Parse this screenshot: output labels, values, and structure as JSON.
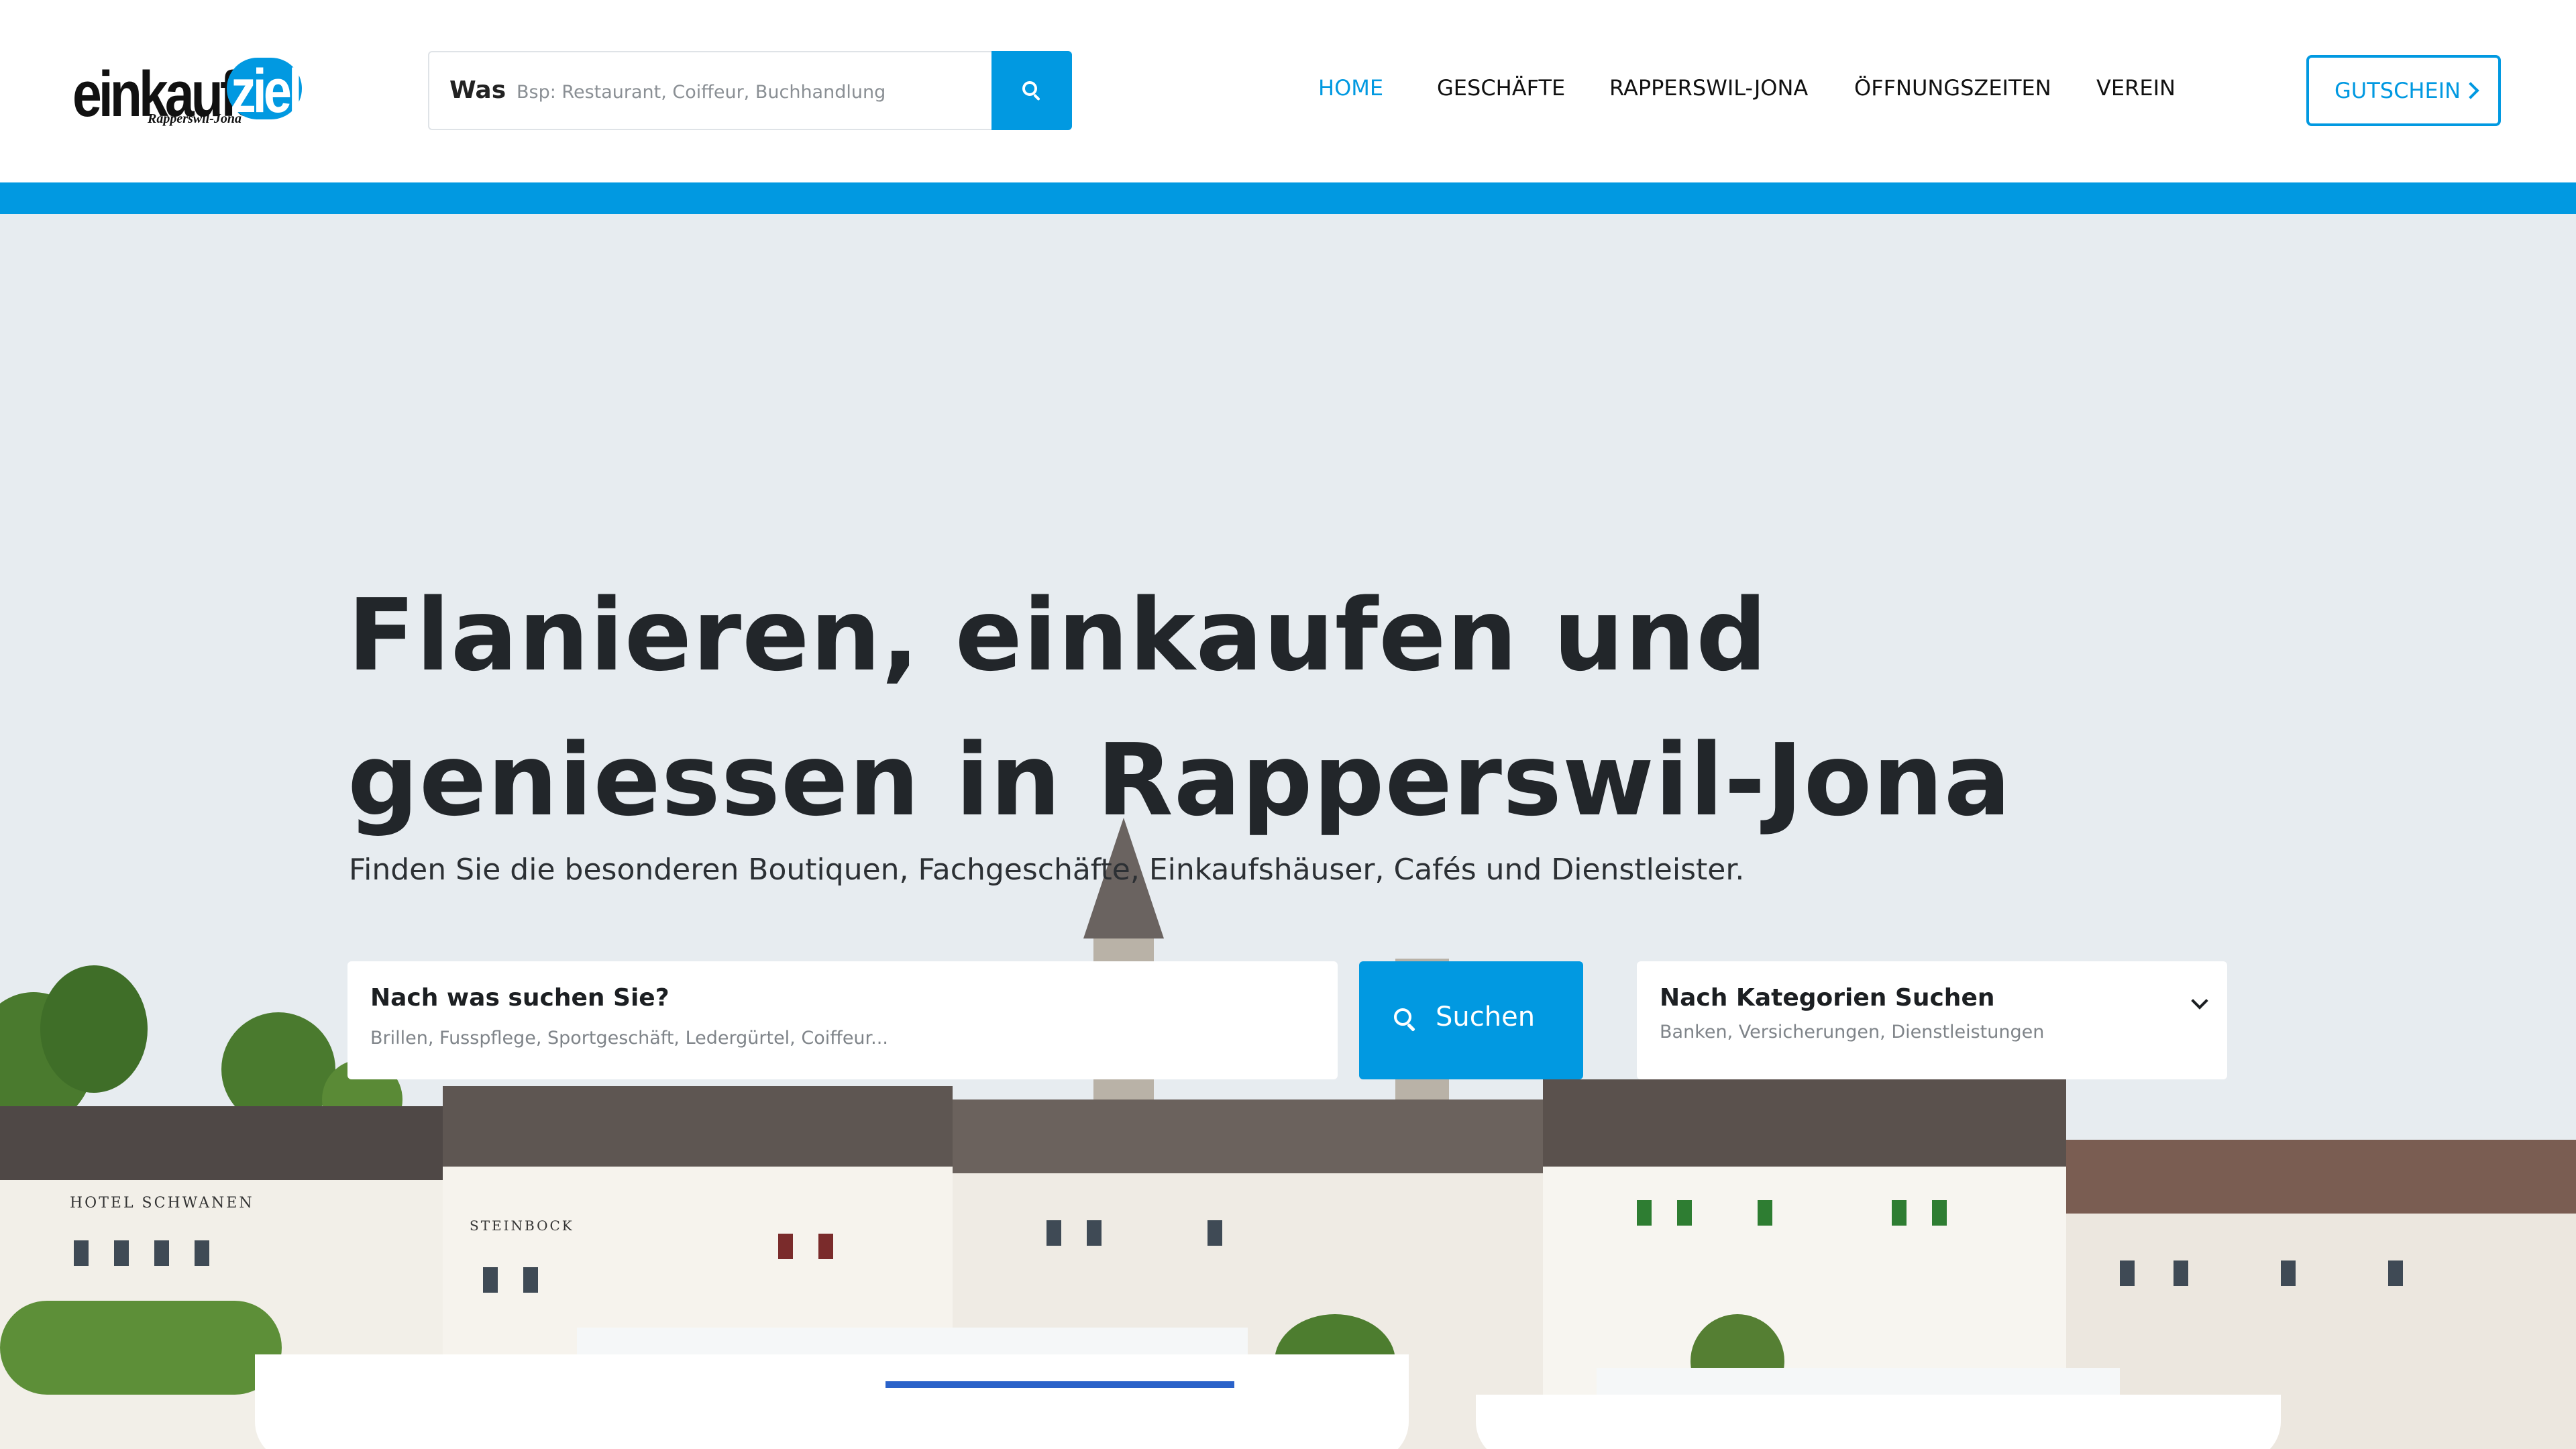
{
  "logo": {
    "word": "einkaufs",
    "ziel": "ziel",
    "sub": "Rapperswil-Jona"
  },
  "header_search": {
    "label": "Was",
    "placeholder": "Bsp: Restaurant, Coiffeur, Buchhandlung",
    "button_icon": "search-icon"
  },
  "nav": {
    "items": [
      {
        "label": "HOME",
        "active": true
      },
      {
        "label": "GESCHÄFTE",
        "active": false
      },
      {
        "label": "RAPPERSWIL-JONA",
        "active": false
      },
      {
        "label": "ÖFFNUNGSZEITEN",
        "active": false
      },
      {
        "label": "VEREIN",
        "active": false
      }
    ]
  },
  "cta": {
    "label": "GUTSCHEIN",
    "icon": "chevron-right-icon"
  },
  "hero": {
    "title_line1": "Flanieren, einkaufen und",
    "title_line2": "geniessen in Rapperswil-Jona",
    "subtitle": "Finden Sie die besonderen Boutiquen, Fachgeschäfte, Einkaufshäuser, Cafés und Dienstleister.",
    "image_signs": [
      "HOTEL SCHWANEN",
      "STEINBOCK"
    ]
  },
  "search_panel": {
    "title": "Nach was suchen Sie?",
    "placeholder": "Brillen, Fusspflege, Sportgeschäft, Ledergürtel, Coiffeur...",
    "button_label": "Suchen"
  },
  "category_panel": {
    "title": "Nach Kategorien Suchen",
    "subtitle": "Banken, Versicherungen, Dienstleistungen",
    "icon": "chevron-down-icon"
  },
  "colors": {
    "accent": "#0199e1",
    "header_bg": "#ffffff",
    "hero_bg": "#e7ecf0",
    "text_dark": "#22262a"
  }
}
